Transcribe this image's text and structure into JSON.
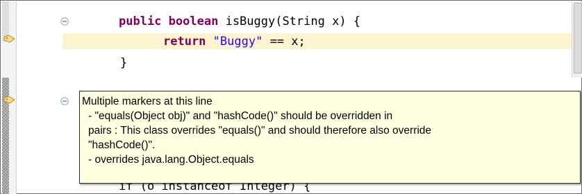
{
  "code": {
    "line1": {
      "kw1": "public",
      "kw2": "boolean",
      "rest": "isBuggy(String x) {"
    },
    "line2": {
      "kw": "return",
      "str": "\"Buggy\"",
      "rest": " == x;"
    },
    "line3": "}",
    "partial_line": "if (o instanceof Integer) {"
  },
  "tooltip": {
    "title": "Multiple markers at this line",
    "item1_line1": "- \"equals(Object obj)\" and \"hashCode()\" should be overridden in",
    "item1_line2": "pairs : This class overrides \"equals()\" and should therefore also override",
    "item1_line3": "\"hashCode()\".",
    "item2": "- overrides java.lang.Object.equals"
  },
  "colors": {
    "keyword": "#7f0055",
    "string": "#2a00ff",
    "current_line_highlight": "#fcf3cf",
    "tooltip_background": "#ffffe1"
  },
  "icons": {
    "marker": "warning-marker-icon",
    "fold": "collapse-fold-icon"
  }
}
